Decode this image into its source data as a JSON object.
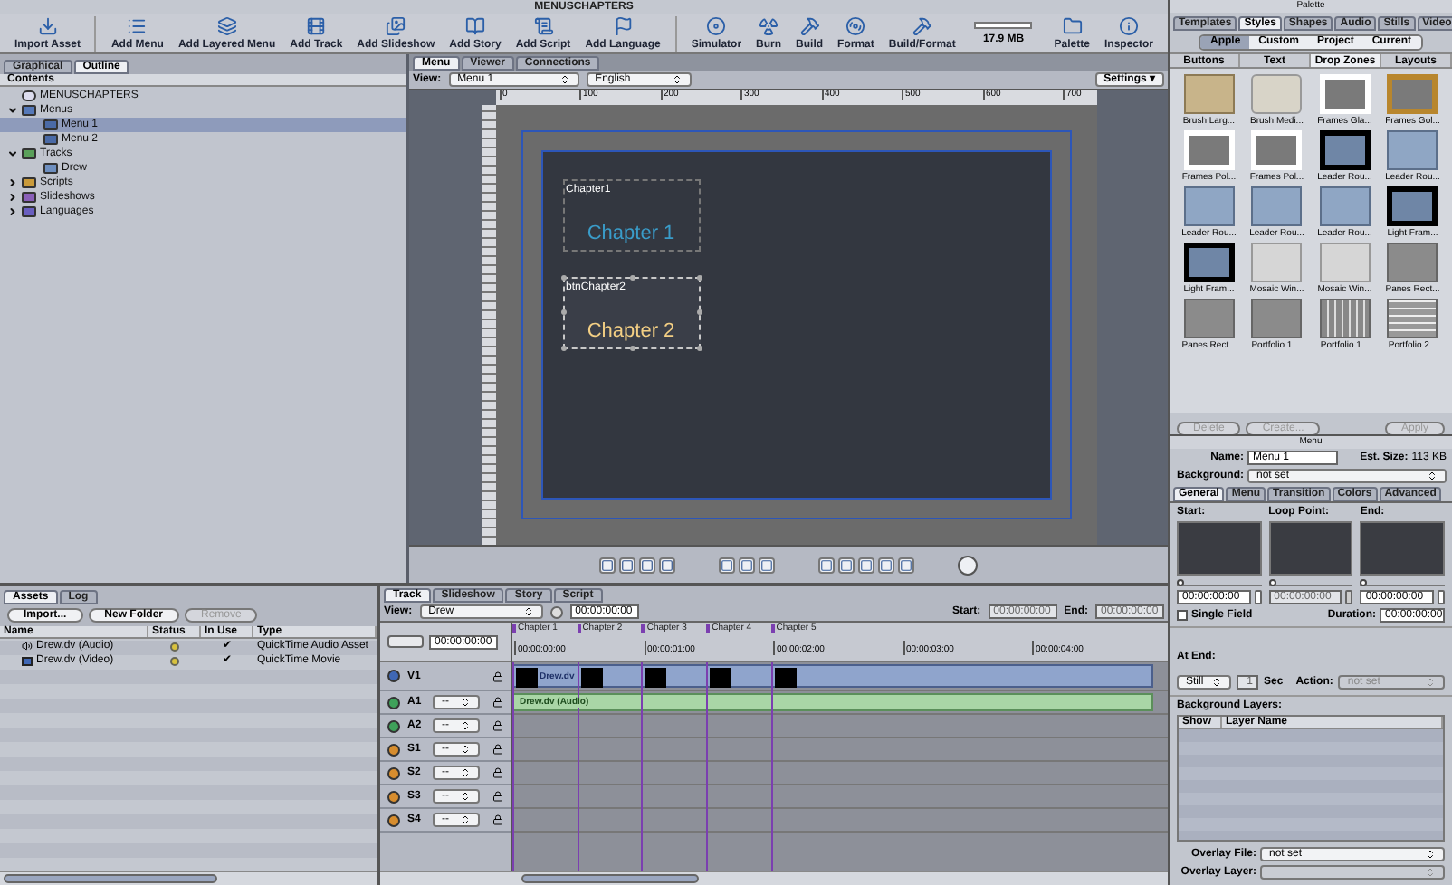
{
  "main_window": {
    "title": "MENUSCHAPTERS"
  },
  "toolbar": {
    "groups": [
      [
        {
          "label": "Import Asset",
          "kind": "import"
        }
      ],
      [
        {
          "label": "Add Menu",
          "kind": "menu"
        },
        {
          "label": "Add Layered Menu",
          "kind": "layered"
        },
        {
          "label": "Add Track",
          "kind": "track"
        },
        {
          "label": "Add Slideshow",
          "kind": "slideshow"
        },
        {
          "label": "Add Story",
          "kind": "story"
        },
        {
          "label": "Add Script",
          "kind": "script"
        },
        {
          "label": "Add Language",
          "kind": "language"
        }
      ],
      [
        {
          "label": "Simulator",
          "kind": "simulator"
        },
        {
          "label": "Burn",
          "kind": "burn"
        },
        {
          "label": "Build",
          "kind": "build"
        },
        {
          "label": "Format",
          "kind": "format"
        },
        {
          "label": "Build/Format",
          "kind": "buildformat"
        }
      ]
    ],
    "memory": {
      "level": 0,
      "reading": "17.9 MB"
    },
    "right": [
      {
        "label": "Palette",
        "kind": "palette"
      },
      {
        "label": "Inspector",
        "kind": "inspector"
      }
    ]
  },
  "outline": {
    "tabs": [
      {
        "label": "Graphical",
        "selected": false
      },
      {
        "label": "Outline",
        "selected": true
      }
    ],
    "header": "Contents",
    "tree": [
      {
        "label": "MENUSCHAPTERS",
        "kind": "project",
        "selected": false
      },
      {
        "label": "Menus",
        "kind": "menus",
        "expanded": true,
        "selected": false,
        "children": [
          {
            "label": "Menu 1",
            "kind": "menu",
            "selected": true
          },
          {
            "label": "Menu 2",
            "kind": "menu",
            "selected": false
          }
        ]
      },
      {
        "label": "Tracks",
        "kind": "tracks",
        "expanded": true,
        "selected": false,
        "children": [
          {
            "label": "Drew",
            "kind": "track",
            "selected": false
          }
        ]
      },
      {
        "label": "Scripts",
        "kind": "scripts",
        "expanded": false,
        "selected": false
      },
      {
        "label": "Slideshows",
        "kind": "slideshows",
        "expanded": false,
        "selected": false
      },
      {
        "label": "Languages",
        "kind": "languages",
        "expanded": false,
        "selected": false
      }
    ]
  },
  "editor": {
    "tabs": [
      {
        "label": "Menu",
        "selected": true
      },
      {
        "label": "Viewer",
        "selected": false
      },
      {
        "label": "Connections",
        "selected": false
      }
    ],
    "view_label": "View:",
    "view": "Menu 1",
    "language": "English",
    "settings": "Settings ▾",
    "ruler": [
      "0",
      "100",
      "200",
      "300",
      "400",
      "500",
      "600",
      "700"
    ],
    "buttons": [
      {
        "name": "Chapter1",
        "text": "Chapter 1",
        "selected": false
      },
      {
        "name": "btnChapter2",
        "text": "Chapter 2",
        "selected": true
      }
    ]
  },
  "assets": {
    "tabs": [
      {
        "label": "Assets",
        "selected": true
      },
      {
        "label": "Log",
        "selected": false
      }
    ],
    "buttons": [
      {
        "label": "Import...",
        "disabled": false
      },
      {
        "label": "New Folder",
        "disabled": false
      },
      {
        "label": "Remove",
        "disabled": true
      }
    ],
    "columns": [
      "Name",
      "Status",
      "In Use",
      "Type"
    ],
    "rows": [
      {
        "name": "Drew.dv (Audio)",
        "kind": "audio",
        "in_use": "✔",
        "type": "QuickTime Audio Asset"
      },
      {
        "name": "Drew.dv (Video)",
        "kind": "video",
        "in_use": "✔",
        "type": "QuickTime Movie"
      }
    ]
  },
  "timeline": {
    "tabs": [
      {
        "label": "Track",
        "selected": true
      },
      {
        "label": "Slideshow",
        "selected": false
      },
      {
        "label": "Story",
        "selected": false
      },
      {
        "label": "Script",
        "selected": false
      }
    ],
    "view_label": "View:",
    "view": "Drew",
    "timecode": "00:00:00:00",
    "start_label": "Start:",
    "start": "00:00:00:00",
    "end_label": "End:",
    "end": "00:00:00:00",
    "playhead": "00:00:00:00",
    "markers": [
      "Chapter 1",
      "Chapter 2",
      "Chapter 3",
      "Chapter 4",
      "Chapter 5"
    ],
    "times": [
      "00:00:00:00",
      "00:00:01:00",
      "00:00:02:00",
      "00:00:03:00",
      "00:00:04:00"
    ],
    "tracks": [
      {
        "name": "V1",
        "kind": "video",
        "clip": "Drew.dv"
      },
      {
        "name": "A1",
        "kind": "audio",
        "popup": "--",
        "clip": "Drew.dv (Audio)"
      },
      {
        "name": "A2",
        "kind": "audio",
        "popup": "--"
      },
      {
        "name": "S1",
        "kind": "subtitle",
        "popup": "--"
      },
      {
        "name": "S2",
        "kind": "subtitle",
        "popup": "--"
      },
      {
        "name": "S3",
        "kind": "subtitle",
        "popup": "--"
      },
      {
        "name": "S4",
        "kind": "subtitle",
        "popup": "--"
      }
    ]
  },
  "palette": {
    "title": "Palette",
    "tabs": [
      {
        "label": "Templates",
        "selected": false
      },
      {
        "label": "Styles",
        "selected": true
      },
      {
        "label": "Shapes",
        "selected": false
      },
      {
        "label": "Audio",
        "selected": false
      },
      {
        "label": "Stills",
        "selected": false
      },
      {
        "label": "Video",
        "selected": false
      }
    ],
    "sources": [
      {
        "label": "Apple",
        "selected": true
      },
      {
        "label": "Custom",
        "selected": false
      },
      {
        "label": "Project",
        "selected": false
      },
      {
        "label": "Current",
        "selected": false
      }
    ],
    "categories": [
      {
        "label": "Buttons",
        "selected": false
      },
      {
        "label": "Text",
        "selected": false
      },
      {
        "label": "Drop Zones",
        "selected": true
      },
      {
        "label": "Layouts",
        "selected": false
      }
    ],
    "styles": [
      {
        "label": "Brush Larg...",
        "kind": "gold"
      },
      {
        "label": "Brush Medi...",
        "kind": "silver"
      },
      {
        "label": "Frames Gla...",
        "kind": "white"
      },
      {
        "label": "Frames Gol...",
        "kind": "goldframe"
      },
      {
        "label": "Frames Pol...",
        "kind": "white"
      },
      {
        "label": "Frames Pol...",
        "kind": "white"
      },
      {
        "label": "Leader Rou...",
        "kind": "dark"
      },
      {
        "label": "Leader Rou...",
        "kind": "blue"
      },
      {
        "label": "Leader Rou...",
        "kind": "blue"
      },
      {
        "label": "Leader Rou...",
        "kind": "blue"
      },
      {
        "label": "Leader Rou...",
        "kind": "blue"
      },
      {
        "label": "Light Fram...",
        "kind": "dark"
      },
      {
        "label": "Light Fram...",
        "kind": "dark"
      },
      {
        "label": "Mosaic Win...",
        "kind": "mosaic"
      },
      {
        "label": "Mosaic Win...",
        "kind": "mosaic"
      },
      {
        "label": "Panes Rect...",
        "kind": "grey"
      },
      {
        "label": "Panes Rect...",
        "kind": "grey"
      },
      {
        "label": "Portfolio 1 ...",
        "kind": "grey"
      },
      {
        "label": "Portfolio 1...",
        "kind": "stripes"
      },
      {
        "label": "Portfolio 2...",
        "kind": "grid"
      }
    ],
    "buttons": [
      {
        "label": "Delete",
        "disabled": true
      },
      {
        "label": "Create...",
        "disabled": true
      },
      {
        "label": "Apply",
        "disabled": true
      }
    ]
  },
  "inspector": {
    "title": "Menu",
    "name_label": "Name:",
    "name": "Menu 1",
    "size_label": "Est. Size:",
    "size": "113 KB",
    "background_label": "Background:",
    "background": "not set",
    "tabs": [
      {
        "label": "General",
        "selected": true
      },
      {
        "label": "Menu",
        "selected": false
      },
      {
        "label": "Transition",
        "selected": false
      },
      {
        "label": "Colors",
        "selected": false
      },
      {
        "label": "Advanced",
        "selected": false
      }
    ],
    "previews": [
      {
        "label": "Start:",
        "timecode": "00:00:00:00",
        "disabled": false,
        "level": 0
      },
      {
        "label": "Loop Point:",
        "timecode": "00:00:00:00",
        "disabled": true,
        "level": 0
      },
      {
        "label": "End:",
        "timecode": "00:00:00:00",
        "disabled": false,
        "level": 0
      }
    ],
    "single_field": {
      "label": "Single Field",
      "checked": false
    },
    "duration_label": "Duration:",
    "duration": "00:00:00:00",
    "at_end_label": "At End:",
    "at_end": "Still",
    "seconds": "1",
    "seconds_unit": "Sec",
    "action_label": "Action:",
    "action": "not set",
    "layers_label": "Background Layers:",
    "layer_columns": [
      "Show",
      "Layer Name"
    ],
    "overlay_file_label": "Overlay File:",
    "overlay_file": "not set",
    "overlay_layer_label": "Overlay Layer:"
  }
}
